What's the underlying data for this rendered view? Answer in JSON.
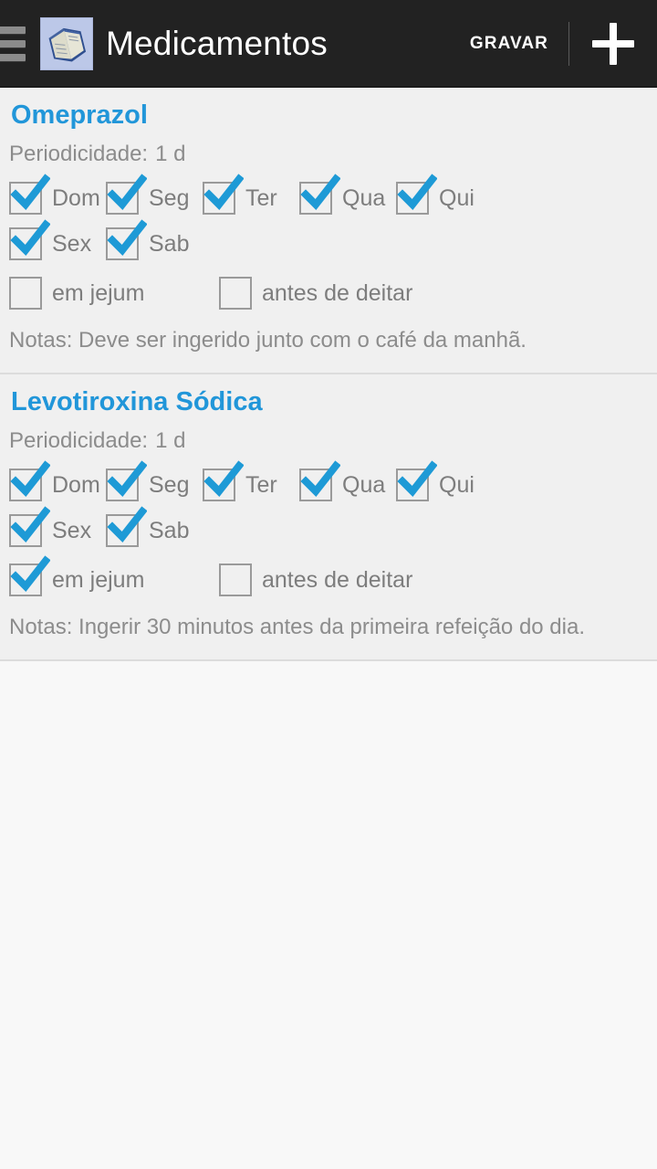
{
  "appbar": {
    "menu_icon": "hamburger-icon",
    "app_icon": "book-icon",
    "title": "Medicamentos",
    "save_label": "GRAVAR",
    "add_icon": "plus-icon",
    "background_color": "#222222",
    "text_color": "#ffffff"
  },
  "theme": {
    "accent": "#2196d9",
    "card_bg": "#f0f0f0",
    "page_bg": "#f8f8f8",
    "muted_text": "#8c8c8c",
    "checkbox_border": "#9a9a9a"
  },
  "medications": [
    {
      "name": "Omeprazol",
      "periodicity_label": "Periodicidade:",
      "periodicity_value": "1 d",
      "days": [
        {
          "label": "Dom",
          "checked": true
        },
        {
          "label": "Seg",
          "checked": true
        },
        {
          "label": "Ter",
          "checked": true
        },
        {
          "label": "Qua",
          "checked": true
        },
        {
          "label": "Qui",
          "checked": true
        },
        {
          "label": "Sex",
          "checked": true
        },
        {
          "label": "Sab",
          "checked": true
        }
      ],
      "options": [
        {
          "label": "em jejum",
          "checked": false
        },
        {
          "label": "antes de deitar",
          "checked": false
        }
      ],
      "notes": "Notas: Deve ser ingerido junto com o café da manhã."
    },
    {
      "name": "Levotiroxina Sódica",
      "periodicity_label": "Periodicidade:",
      "periodicity_value": "1 d",
      "days": [
        {
          "label": "Dom",
          "checked": true
        },
        {
          "label": "Seg",
          "checked": true
        },
        {
          "label": "Ter",
          "checked": true
        },
        {
          "label": "Qua",
          "checked": true
        },
        {
          "label": "Qui",
          "checked": true
        },
        {
          "label": "Sex",
          "checked": true
        },
        {
          "label": "Sab",
          "checked": true
        }
      ],
      "options": [
        {
          "label": "em jejum",
          "checked": true
        },
        {
          "label": "antes de deitar",
          "checked": false
        }
      ],
      "notes": "Notas: Ingerir 30 minutos antes da primeira refeição do dia."
    }
  ]
}
